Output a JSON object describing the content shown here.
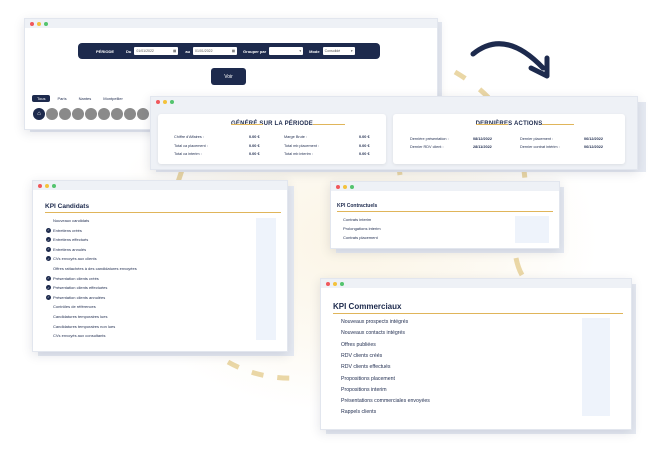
{
  "filter": {
    "periode_label": "PÉRIODE",
    "du_label": "Du",
    "date_from": "01/01/2022",
    "au_label": "au",
    "date_to": "01/01/2022",
    "grouper_label": "Grouper par",
    "mode_label": "Mode",
    "mode_value": "Consolidé",
    "voir_label": "Voir"
  },
  "tabs": [
    "Tous",
    "Paris",
    "Nantes",
    "Montpellier"
  ],
  "summary": {
    "genere_title": "GÉNÉRÉ SUR LA PÉRIODE",
    "left_rows": [
      {
        "label": "Chiffre d'Affaires :",
        "value": "0.00 €"
      },
      {
        "label": "Total ca placement :",
        "value": "0.00 €"
      },
      {
        "label": "Total ca interim :",
        "value": "0.00 €"
      }
    ],
    "mid_rows": [
      {
        "label": "Marge Brute :",
        "value": "0.00 €"
      },
      {
        "label": "Total mb placement :",
        "value": "0.00 €"
      },
      {
        "label": "Total mb interim :",
        "value": "0.00 €"
      }
    ],
    "actions_title": "DERNIÈRES ACTIONS",
    "act_left": [
      {
        "label": "Dernière présentation :",
        "value": "08/12/2022"
      },
      {
        "label": "Dernier RDV client :",
        "value": "28/11/2022"
      }
    ],
    "act_right": [
      {
        "label": "Dernier placement :",
        "value": "06/12/2022"
      },
      {
        "label": "Dernier contrat intérim :",
        "value": "06/12/2022"
      }
    ]
  },
  "candidats": {
    "title": "KPI Candidats",
    "items": [
      {
        "label": "Nouveaux candidats",
        "check": false
      },
      {
        "label": "Entretiens créés",
        "check": true
      },
      {
        "label": "Entretiens effectués",
        "check": true
      },
      {
        "label": "Entretiens annulés",
        "check": true
      },
      {
        "label": "CVs envoyés aux clients",
        "check": true
      },
      {
        "label": "Offres rattachées à des candidatures envoyées",
        "check": false
      },
      {
        "label": "Présentation clients créés",
        "check": true
      },
      {
        "label": "Présentation clients effectuées",
        "check": true
      },
      {
        "label": "Présentation clients annulées",
        "check": true
      },
      {
        "label": "Contrôles de références",
        "check": false
      },
      {
        "label": "Candidatures temporaires lues",
        "check": false
      },
      {
        "label": "Candidatures temporaires non lues",
        "check": false
      },
      {
        "label": "CVs envoyés aux consultants",
        "check": false
      }
    ]
  },
  "contractuels": {
    "title": "KPI Contractuels",
    "items": [
      "Contrats interim",
      "Prolongations interim",
      "Contrats placement"
    ]
  },
  "commerciaux": {
    "title": "KPI Commerciaux",
    "items": [
      "Nouveaux prospects intégrés",
      "Nouveaux contacts intégrés",
      "Offres publiées",
      "RDV clients créés",
      "RDV clients effectués",
      "Propositions placement",
      "Propositions interim",
      "Présentations commerciales envoyées",
      "Rappels clients"
    ]
  }
}
